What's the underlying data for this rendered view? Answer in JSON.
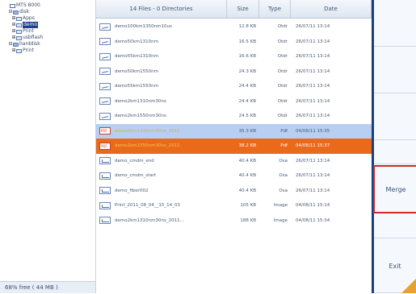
{
  "tree": {
    "items": [
      {
        "indent": 0,
        "expander": "",
        "icon": "root",
        "label": "MTS 8000",
        "selected": false
      },
      {
        "indent": 1,
        "expander": "⊟",
        "icon": "disk",
        "label": "disk",
        "selected": false
      },
      {
        "indent": 2,
        "expander": "⊞",
        "icon": "folder",
        "label": "Apps",
        "selected": false
      },
      {
        "indent": 2,
        "expander": "⊞",
        "icon": "folder",
        "label": "demo",
        "selected": true
      },
      {
        "indent": 2,
        "expander": "⊞",
        "icon": "folder",
        "label": "Print",
        "selected": false
      },
      {
        "indent": 2,
        "expander": "⊞",
        "icon": "folder",
        "label": "usbflash",
        "selected": false
      },
      {
        "indent": 1,
        "expander": "⊟",
        "icon": "disk",
        "label": "harddisk",
        "selected": false
      },
      {
        "indent": 2,
        "expander": "⊞",
        "icon": "folder",
        "label": "Print",
        "selected": false
      }
    ],
    "free_text": "68% free ( 44 MB )"
  },
  "list": {
    "header": {
      "name": "14 Files - 0 Directories",
      "size": "Size",
      "type": "Type",
      "date": "Date"
    },
    "rows": [
      {
        "icon": "otdr",
        "name": "demo100km1350nm10us",
        "size": "12.8 KB",
        "type": "Otdr",
        "date": "26/07/11 13:14",
        "state": ""
      },
      {
        "icon": "otdr",
        "name": "demo50km1310nm",
        "size": "16.5 KB",
        "type": "Otdr",
        "date": "26/07/11 13:14",
        "state": ""
      },
      {
        "icon": "otdr",
        "name": "demo55km1310nm",
        "size": "16.6 KB",
        "type": "Otdr",
        "date": "26/07/11 13:14",
        "state": ""
      },
      {
        "icon": "otdr",
        "name": "demo50km1550nm",
        "size": "24.3 KB",
        "type": "Otdr",
        "date": "26/07/11 13:14",
        "state": ""
      },
      {
        "icon": "otdr",
        "name": "demo55km1550nm",
        "size": "24.4 KB",
        "type": "Otdr",
        "date": "26/07/11 13:14",
        "state": ""
      },
      {
        "icon": "otdr",
        "name": "demo2km1310nm30ns",
        "size": "24.4 KB",
        "type": "Otdr",
        "date": "26/07/11 13:14",
        "state": ""
      },
      {
        "icon": "otdr",
        "name": "demo2km1550nm30ns",
        "size": "24.5 KB",
        "type": "Otdr",
        "date": "26/07/11 13:14",
        "state": ""
      },
      {
        "icon": "pdf",
        "name": "demo2km1310nm30ns_2011",
        "size": "35.3 KB",
        "type": "Pdf",
        "date": "04/08/11 15:35",
        "state": "sel-blue"
      },
      {
        "icon": "pdf",
        "name": "demo2km1550nm30ns_2011",
        "size": "38.2 KB",
        "type": "Pdf",
        "date": "04/08/11 15:37",
        "state": "sel-orange"
      },
      {
        "icon": "osa",
        "name": "demo_cmdm_end",
        "size": "40.4 KB",
        "type": "Osa",
        "date": "26/07/11 13:14",
        "state": ""
      },
      {
        "icon": "osa",
        "name": "demo_cmdm_start",
        "size": "40.4 KB",
        "type": "Osa",
        "date": "26/07/11 13:14",
        "state": ""
      },
      {
        "icon": "osa",
        "name": "demo_fiber002",
        "size": "40.4 KB",
        "type": "Osa",
        "date": "26/07/11 13:14",
        "state": ""
      },
      {
        "icon": "img",
        "name": "Print_2011_08_04__15_14_03",
        "size": "105 KB",
        "type": "Image",
        "date": "04/08/11 15:14",
        "state": ""
      },
      {
        "icon": "img",
        "name": "demo2km1310nm30ns_2011...",
        "size": "188 KB",
        "type": "Image",
        "date": "04/08/11 15:34",
        "state": ""
      }
    ]
  },
  "side": {
    "merge_label": "Merge",
    "exit_label": "Exit"
  },
  "colors": {
    "accent": "#1c3f7e",
    "highlight_border": "#cc2a2a",
    "selected_orange": "#ea6a1c",
    "selected_blue": "#b8cff2"
  }
}
